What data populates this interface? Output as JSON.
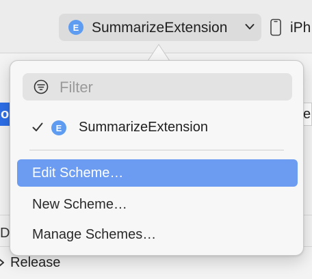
{
  "toolbar": {
    "scheme_icon_letter": "E",
    "scheme_name": "SummarizeExtension",
    "device_name": "iPh"
  },
  "background": {
    "left_tab_text": "o",
    "right_tab_text": "e",
    "row_peek_text": "D",
    "release_label": "Release"
  },
  "popover": {
    "filter": {
      "placeholder": "Filter"
    },
    "schemes": [
      {
        "icon_letter": "E",
        "label": "SummarizeExtension",
        "checked": true
      }
    ],
    "menu_items": [
      {
        "label": "Edit Scheme…",
        "highlighted": true
      },
      {
        "label": "New Scheme…",
        "highlighted": false
      },
      {
        "label": "Manage Schemes…",
        "highlighted": false
      }
    ]
  },
  "colors": {
    "accent_highlight": "#6b9cf2",
    "scheme_badge": "#5d9cf0"
  }
}
